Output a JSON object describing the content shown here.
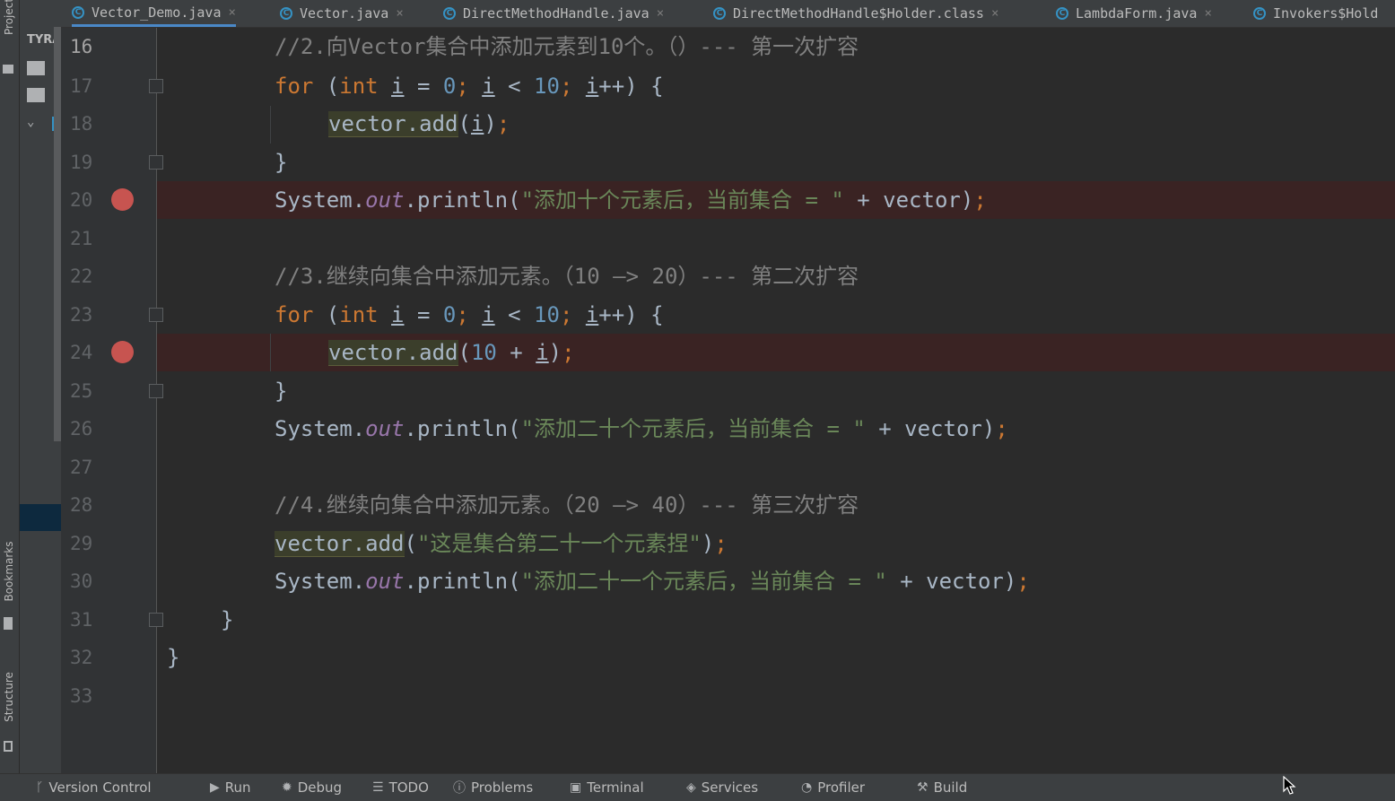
{
  "tool_labels": {
    "project": "Project",
    "bookmarks": "Bookmarks",
    "structure": "Structure",
    "project_panel_title": "TYRA"
  },
  "tabs": [
    {
      "label": "Vector_Demo.java",
      "active": true,
      "closable": true
    },
    {
      "label": "Vector.java",
      "active": false,
      "closable": true
    },
    {
      "label": "DirectMethodHandle.java",
      "active": false,
      "closable": true
    },
    {
      "label": "DirectMethodHandle$Holder.class",
      "active": false,
      "closable": true
    },
    {
      "label": "LambdaForm.java",
      "active": false,
      "closable": true
    },
    {
      "label": "Invokers$Hold",
      "active": false,
      "closable": false
    }
  ],
  "tab_icon_letter": "C",
  "tab_close_glyph": "×",
  "editor": {
    "current_line": "16",
    "breakpoint_lines": [
      "20",
      "24"
    ],
    "lines": [
      {
        "num": "16",
        "parts": [
          {
            "c": "cmt",
            "t": "//2.向Vector集合中添加元素到10个。（）--- 第一次扩容"
          }
        ]
      },
      {
        "num": "17",
        "parts": [
          {
            "c": "kw",
            "t": "for "
          },
          {
            "c": "",
            "t": "("
          },
          {
            "c": "kw",
            "t": "int "
          },
          {
            "c": "u",
            "t": "i"
          },
          {
            "c": "",
            "t": " = "
          },
          {
            "c": "num",
            "t": "0"
          },
          {
            "c": "kw",
            "t": "; "
          },
          {
            "c": "u",
            "t": "i"
          },
          {
            "c": "",
            "t": " < "
          },
          {
            "c": "num",
            "t": "10"
          },
          {
            "c": "kw",
            "t": "; "
          },
          {
            "c": "u",
            "t": "i"
          },
          {
            "c": "",
            "t": "++) {"
          }
        ]
      },
      {
        "num": "18",
        "parts": [
          {
            "c": "hl",
            "t": "vector.add"
          },
          {
            "c": "",
            "t": "("
          },
          {
            "c": "u",
            "t": "i"
          },
          {
            "c": "",
            "t": ")"
          },
          {
            "c": "kw",
            "t": ";"
          }
        ]
      },
      {
        "num": "19",
        "parts": [
          {
            "c": "",
            "t": "}"
          }
        ]
      },
      {
        "num": "20",
        "parts": [
          {
            "c": "",
            "t": "System."
          },
          {
            "c": "field",
            "t": "out"
          },
          {
            "c": "",
            "t": ".println("
          },
          {
            "c": "str",
            "t": "\"添加十个元素后，当前集合 = \""
          },
          {
            "c": "",
            "t": " + vector)"
          },
          {
            "c": "kw",
            "t": ";"
          }
        ]
      },
      {
        "num": "21",
        "parts": []
      },
      {
        "num": "22",
        "parts": [
          {
            "c": "cmt",
            "t": "//3.继续向集合中添加元素。（10 —> 20）--- 第二次扩容"
          }
        ]
      },
      {
        "num": "23",
        "parts": [
          {
            "c": "kw",
            "t": "for "
          },
          {
            "c": "",
            "t": "("
          },
          {
            "c": "kw",
            "t": "int "
          },
          {
            "c": "u",
            "t": "i"
          },
          {
            "c": "",
            "t": " = "
          },
          {
            "c": "num",
            "t": "0"
          },
          {
            "c": "kw",
            "t": "; "
          },
          {
            "c": "u",
            "t": "i"
          },
          {
            "c": "",
            "t": " < "
          },
          {
            "c": "num",
            "t": "10"
          },
          {
            "c": "kw",
            "t": "; "
          },
          {
            "c": "u",
            "t": "i"
          },
          {
            "c": "",
            "t": "++) {"
          }
        ]
      },
      {
        "num": "24",
        "parts": [
          {
            "c": "hl",
            "t": "vector.add"
          },
          {
            "c": "",
            "t": "("
          },
          {
            "c": "num",
            "t": "10"
          },
          {
            "c": "",
            "t": " + "
          },
          {
            "c": "u",
            "t": "i"
          },
          {
            "c": "",
            "t": ")"
          },
          {
            "c": "kw",
            "t": ";"
          }
        ]
      },
      {
        "num": "25",
        "parts": [
          {
            "c": "",
            "t": "}"
          }
        ]
      },
      {
        "num": "26",
        "parts": [
          {
            "c": "",
            "t": "System."
          },
          {
            "c": "field",
            "t": "out"
          },
          {
            "c": "",
            "t": ".println("
          },
          {
            "c": "str",
            "t": "\"添加二十个元素后，当前集合 = \""
          },
          {
            "c": "",
            "t": " + vector)"
          },
          {
            "c": "kw",
            "t": ";"
          }
        ]
      },
      {
        "num": "27",
        "parts": []
      },
      {
        "num": "28",
        "parts": [
          {
            "c": "cmt",
            "t": "//4.继续向集合中添加元素。（20 —> 40）--- 第三次扩容"
          }
        ]
      },
      {
        "num": "29",
        "parts": [
          {
            "c": "hl",
            "t": "vector.add"
          },
          {
            "c": "",
            "t": "("
          },
          {
            "c": "str",
            "t": "\"这是集合第二十一个元素捏\""
          },
          {
            "c": "",
            "t": ")"
          },
          {
            "c": "kw",
            "t": ";"
          }
        ]
      },
      {
        "num": "30",
        "parts": [
          {
            "c": "",
            "t": "System."
          },
          {
            "c": "field",
            "t": "out"
          },
          {
            "c": "",
            "t": ".println("
          },
          {
            "c": "str",
            "t": "\"添加二十一个元素后，当前集合 = \""
          },
          {
            "c": "",
            "t": " + vector)"
          },
          {
            "c": "kw",
            "t": ";"
          }
        ]
      },
      {
        "num": "31",
        "parts": [
          {
            "c": "",
            "t": "}"
          }
        ]
      },
      {
        "num": "32",
        "parts": [
          {
            "c": "",
            "t": "}"
          }
        ]
      },
      {
        "num": "33",
        "parts": []
      }
    ]
  },
  "statusbar": [
    {
      "label": "Version Control",
      "icon": "branch-icon"
    },
    {
      "label": "Run",
      "icon": "run-icon"
    },
    {
      "label": "Debug",
      "icon": "debug-icon"
    },
    {
      "label": "TODO",
      "icon": "list-icon"
    },
    {
      "label": "Problems",
      "icon": "info-icon"
    },
    {
      "label": "Terminal",
      "icon": "terminal-icon"
    },
    {
      "label": "Services",
      "icon": "services-icon"
    },
    {
      "label": "Profiler",
      "icon": "profiler-icon"
    },
    {
      "label": "Build",
      "icon": "hammer-icon"
    }
  ],
  "colors": {
    "background": "#2b2b2b",
    "keyword": "#cc7832",
    "number": "#6897bb",
    "string": "#6a8759",
    "comment": "#808080",
    "field": "#9876aa",
    "breakpoint": "#c75450"
  }
}
